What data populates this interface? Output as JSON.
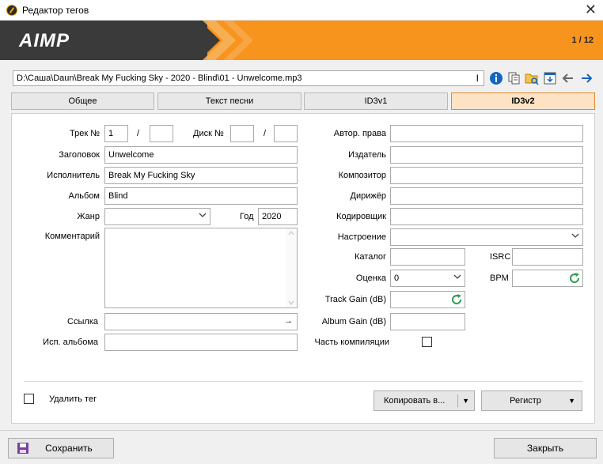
{
  "window": {
    "title": "Редактор тегов",
    "close_glyph": "✕"
  },
  "banner": {
    "logo": "AIMP",
    "counter": "1 / 12",
    "accent": "#f7941d",
    "dark": "#3a3a3a"
  },
  "path": {
    "value": "D:\\Саша\\Daun\\Break My Fucking Sky  - 2020 - Blind\\01 - Unwelcome.mp3"
  },
  "toolbar_icons": [
    "info-icon",
    "copy-icon",
    "find-file-icon",
    "save-download-icon",
    "arrow-left-icon",
    "arrow-right-icon"
  ],
  "tabs": [
    {
      "label": "Общее"
    },
    {
      "label": "Текст песни"
    },
    {
      "label": "ID3v1"
    },
    {
      "label": "ID3v2"
    }
  ],
  "left": {
    "track_label": "Трек №",
    "track": "1",
    "track_total": "",
    "slash": "/",
    "disc_label": "Диск №",
    "disc": "",
    "disc_total": "",
    "title_label": "Заголовок",
    "title": "Unwelcome",
    "artist_label": "Исполнитель",
    "artist": "Break My Fucking Sky",
    "album_label": "Альбом",
    "album": "Blind",
    "genre_label": "Жанр",
    "genre": "",
    "year_label": "Год",
    "year": "2020",
    "comment_label": "Комментарий",
    "comment": "",
    "link_label": "Ссылка",
    "link": "",
    "link_glyph": "→",
    "album_artist_label": "Исп. альбома",
    "album_artist": ""
  },
  "right": {
    "copyright_label": "Автор. права",
    "copyright": "",
    "publisher_label": "Издатель",
    "publisher": "",
    "composer_label": "Композитор",
    "composer": "",
    "conductor_label": "Дирижёр",
    "conductor": "",
    "encoder_label": "Кодировщик",
    "encoder": "",
    "mood_label": "Настроение",
    "mood": "",
    "catalog_label": "Каталог",
    "catalog": "",
    "isrc_label": "ISRC",
    "isrc": "",
    "rating_label": "Оценка",
    "rating": "0",
    "bpm_label": "BPM",
    "bpm": "",
    "track_gain_label": "Track Gain (dB)",
    "track_gain": "",
    "album_gain_label": "Album Gain (dB)",
    "album_gain": "",
    "compilation_label": "Часть компиляции"
  },
  "footer": {
    "delete_tag_label": "Удалить тег",
    "copy_button": "Копировать в...",
    "case_button": "Регистр",
    "dropdown_glyph": "▼"
  },
  "bottom": {
    "save": "Сохранить",
    "close": "Закрыть"
  }
}
